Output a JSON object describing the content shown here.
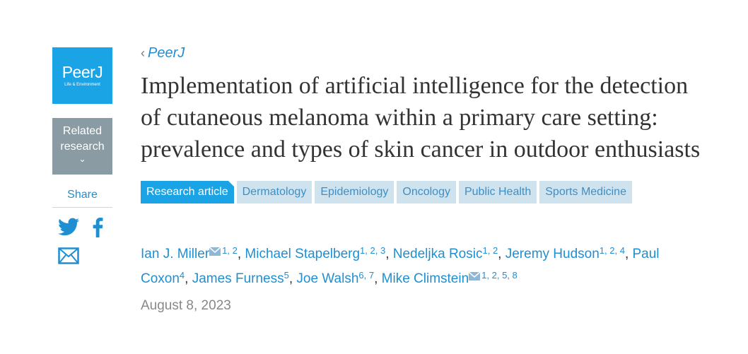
{
  "sidebar": {
    "logo_brand": "PeerJ",
    "logo_brand_main": "Peer",
    "logo_brand_j": "J",
    "logo_tagline": "Life & Environment",
    "related_line1": "Related",
    "related_line2": "research",
    "related_chevron": "⌄",
    "share_label": "Share",
    "share_icons": [
      "twitter-icon",
      "facebook-icon",
      "mail-icon"
    ]
  },
  "breadcrumb": {
    "chevron": "‹",
    "label": "PeerJ"
  },
  "article": {
    "title": "Implementation of artificial intelligence for the detection of cutaneous melanoma within a primary care setting: prevalence and types of skin cancer in outdoor enthusiasts",
    "tags": [
      "Research article",
      "Dermatology",
      "Epidemiology",
      "Oncology",
      "Public Health",
      "Sports Medicine"
    ],
    "authors": [
      {
        "name": "Ian J. Miller",
        "email": true,
        "aff": "1, 2"
      },
      {
        "name": "Michael Stapelberg",
        "email": false,
        "aff": "1, 2, 3"
      },
      {
        "name": "Nedeljka Rosic",
        "email": false,
        "aff": "1, 2"
      },
      {
        "name": "Jeremy Hudson",
        "email": false,
        "aff": "1, 2, 4"
      },
      {
        "name": "Paul Coxon",
        "email": false,
        "aff": "4"
      },
      {
        "name": "James Furness",
        "email": false,
        "aff": "5"
      },
      {
        "name": "Joe Walsh",
        "email": false,
        "aff": "6, 7"
      },
      {
        "name": "Mike Climstein",
        "email": true,
        "aff": "1, 2, 5, 8"
      }
    ],
    "date": "August 8, 2023"
  },
  "colors": {
    "brand": "#1aa4e6",
    "link": "#1f8fd1",
    "tag_bg": "#cfe3ef",
    "related_bg": "#8b9ba3"
  }
}
